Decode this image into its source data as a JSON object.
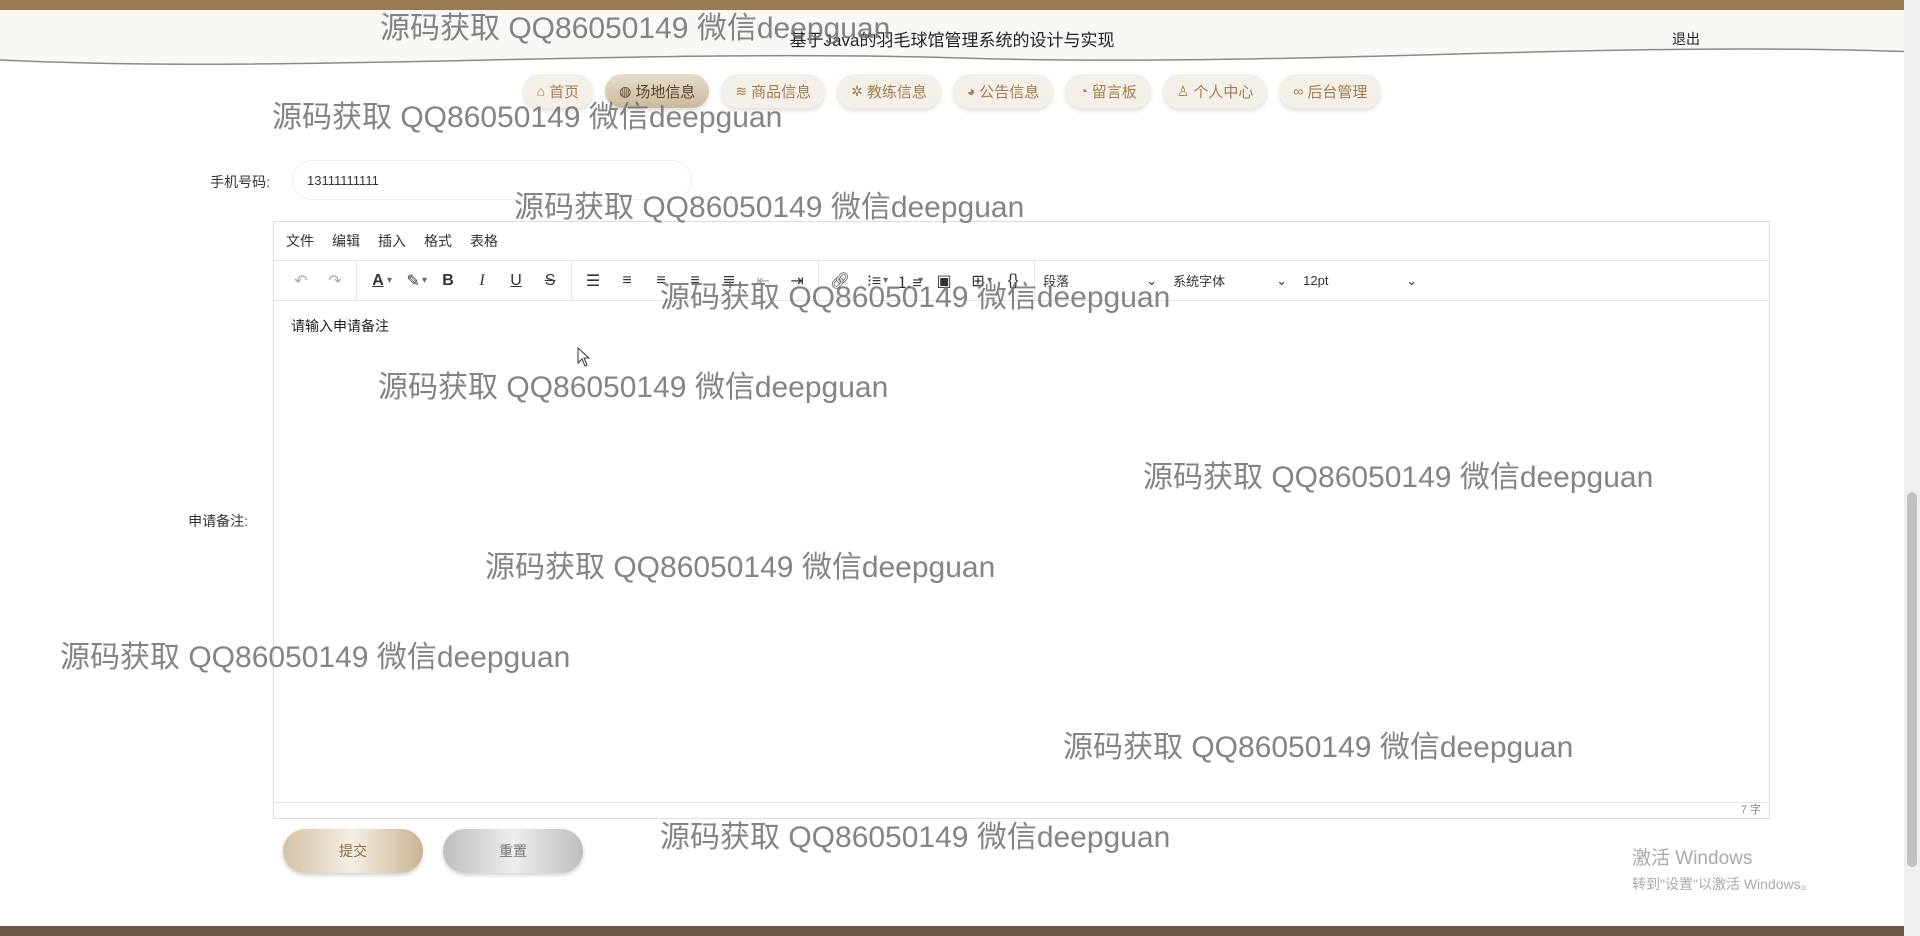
{
  "header": {
    "title": "基于Java的羽毛球馆管理系统的设计与实现",
    "logout": "退出"
  },
  "nav": {
    "items": [
      {
        "label": "首页",
        "icon": "home-icon",
        "glyph": "⌂"
      },
      {
        "label": "场地信息",
        "icon": "globe-icon",
        "glyph": "◍",
        "active": true
      },
      {
        "label": "商品信息",
        "icon": "layers-icon",
        "glyph": "≋"
      },
      {
        "label": "教练信息",
        "icon": "gear-icon",
        "glyph": "✲"
      },
      {
        "label": "公告信息",
        "icon": "palette-icon",
        "glyph": "◕"
      },
      {
        "label": "留言板",
        "icon": "dashboard-icon",
        "glyph": "◔"
      },
      {
        "label": "个人中心",
        "icon": "user-icon",
        "glyph": "♙"
      },
      {
        "label": "后台管理",
        "icon": "link-icon",
        "glyph": "∞"
      }
    ]
  },
  "form": {
    "phone_label": "手机号码:",
    "phone_value": "13111111111",
    "remark_label": "申请备注:"
  },
  "editor": {
    "menus": [
      "文件",
      "编辑",
      "插入",
      "格式",
      "表格"
    ],
    "paragraph_select": "段落",
    "font_select": "系统字体",
    "size_select": "12pt",
    "content": "请输入申请备注",
    "word_count": "7 字"
  },
  "buttons": {
    "submit": "提交",
    "reset": "重置"
  },
  "watermark": "源码获取 QQ86050149 微信deepguan",
  "windows_activation": {
    "line1": "激活 Windows",
    "line2": "转到\"设置\"以激活 Windows。"
  },
  "colors": {
    "brand_brown": "#9a7a4e",
    "nav_text": "#a37e52",
    "bottom_bar": "#6b5844"
  }
}
